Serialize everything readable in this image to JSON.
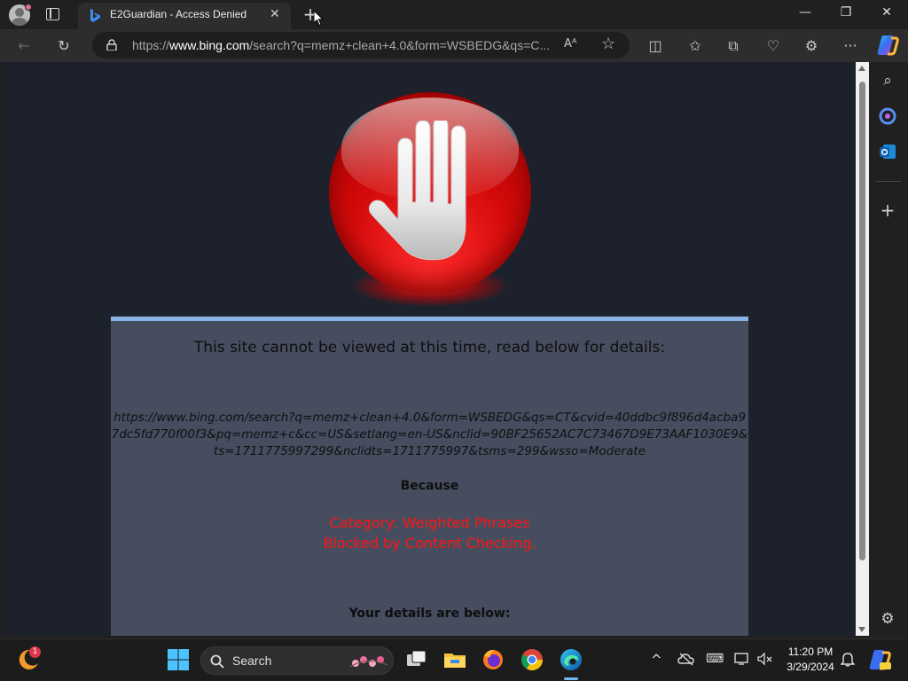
{
  "browser": {
    "tab": {
      "title": "E2Guardian - Access Denied",
      "close_glyph": "✕"
    },
    "new_tab_glyph": "+",
    "window_controls": {
      "minimize": "—",
      "restore": "❐",
      "close": "✕"
    },
    "address": {
      "scheme": "https://",
      "domain": "www.bing.com",
      "path": "/search?q=memz+clean+4.0&form=WSBEDG&qs=C...",
      "read_aloud_glyph": "Aᴬ",
      "favorite_glyph": "☆"
    },
    "toolbar_glyphs": {
      "back": "←",
      "refresh": "↻",
      "split": "◫",
      "favorites": "✩",
      "collections": "⧉",
      "health": "♡",
      "extensions": "⚙",
      "more": "···"
    }
  },
  "page": {
    "heading": "This site cannot be viewed at this time, read below for details:",
    "blocked_url": "https://www.bing.com/search?q=memz+clean+4.0&form=WSBEDG&qs=CT&cvid=40ddbc9f896d4acba97dc5fd770f00f3&pq=memz+c&cc=US&setlang=en-US&nclid=90BF25652AC7C73467D9E73AAF1030E9&ts=1711775997299&nclidts=1711775997&tsms=299&wsso=Moderate",
    "because_label": "Because",
    "reason_category": "Category: Weighted Phrases",
    "reason_detail": "Blocked by Content Checking.",
    "details_label": "Your details are below:"
  },
  "sidebar": {
    "search_glyph": "⌕",
    "add_glyph": "+",
    "settings_glyph": "⚙"
  },
  "taskbar": {
    "weather_badge": "1",
    "search_label": "Search",
    "tray": {
      "chevron": "^",
      "keyboard": "⌨"
    },
    "clock_time": "11:20 PM",
    "clock_date": "3/29/2024"
  },
  "colors": {
    "page_bg": "#1d212c",
    "panel_bg": "#464d5f",
    "panel_top_border": "#8ab4e8",
    "reason_text": "#ff1414",
    "stop_red": "#e01010"
  }
}
